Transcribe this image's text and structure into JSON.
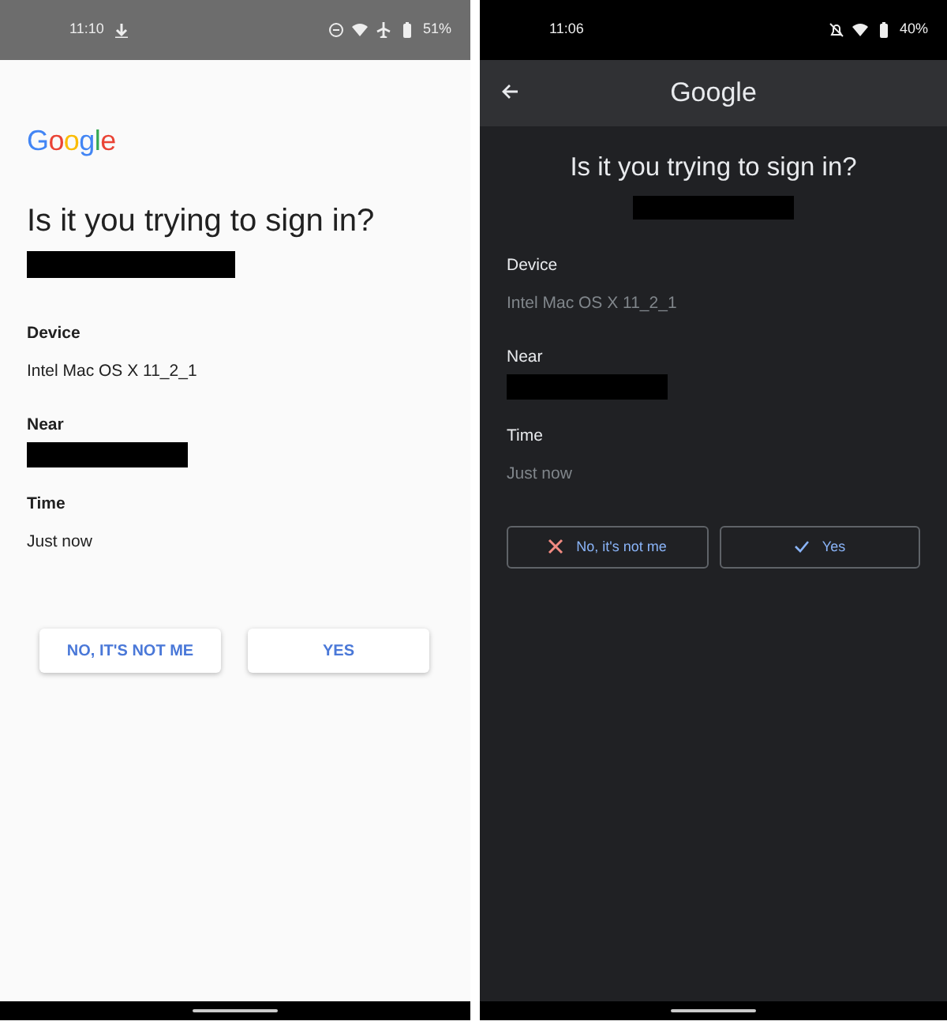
{
  "screens": [
    {
      "kind": "light",
      "status_bar": {
        "time": "11:10",
        "battery": "51%"
      },
      "logo": "Google",
      "heading": "Is it you trying to sign in?",
      "account": {
        "redacted": true
      },
      "details": [
        {
          "label": "Device",
          "value": "Intel Mac OS X 11_2_1"
        },
        {
          "label": "Near",
          "redacted": true
        },
        {
          "label": "Time",
          "value": "Just now"
        }
      ],
      "buttons": [
        {
          "label": "NO, IT'S NOT ME"
        },
        {
          "label": "YES"
        }
      ]
    },
    {
      "kind": "dark",
      "status_bar": {
        "time": "11:06",
        "battery": "40%"
      },
      "app_bar": {
        "title": "Google"
      },
      "heading": "Is it you trying to sign in?",
      "account": {
        "redacted": true
      },
      "details": [
        {
          "label": "Device",
          "value": "Intel Mac OS X 11_2_1"
        },
        {
          "label": "Near",
          "redacted": true
        },
        {
          "label": "Time",
          "value": "Just now"
        }
      ],
      "buttons": [
        {
          "label": "No, it's not me"
        },
        {
          "label": "Yes"
        }
      ]
    }
  ]
}
